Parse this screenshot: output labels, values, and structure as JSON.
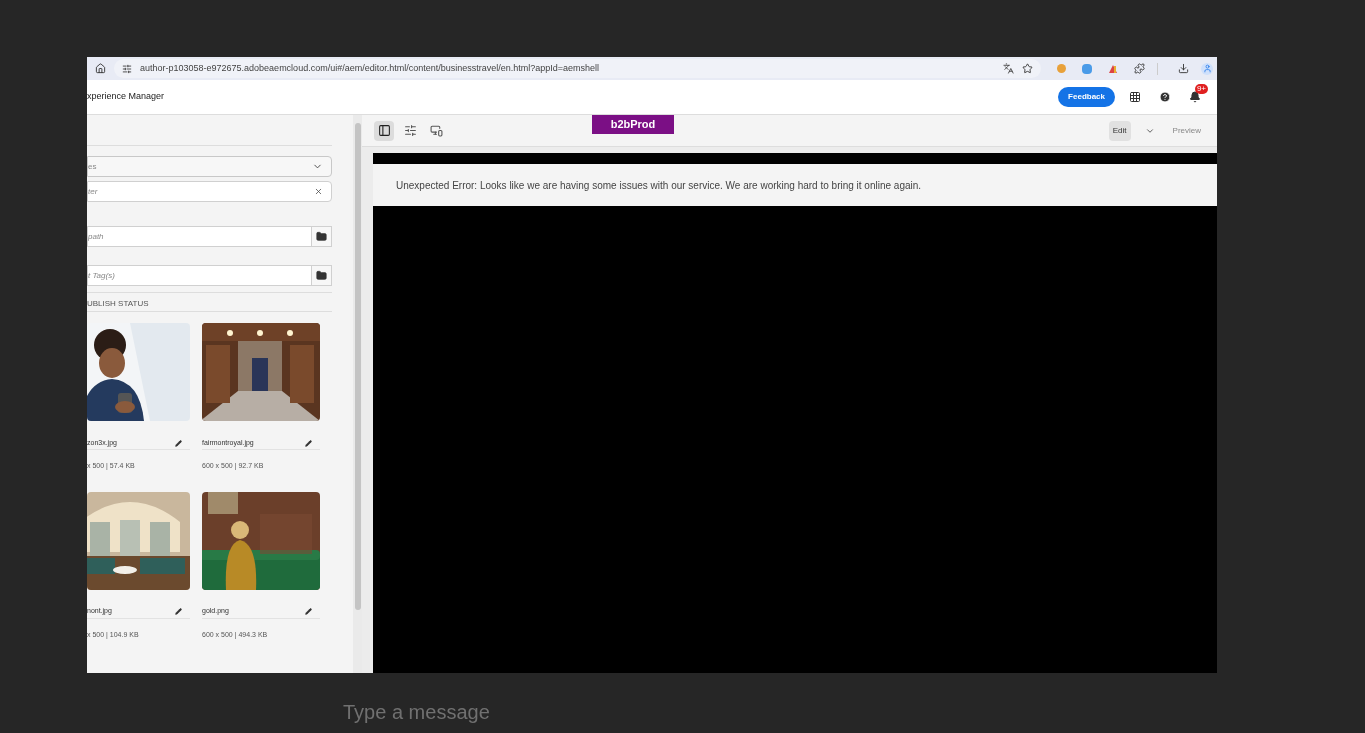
{
  "browser": {
    "url": "author-p103058-e972675.adobeaemcloud.com/ui#/aem/editor.html/content/businesstravel/en.html?appId=aemshell"
  },
  "app_header": {
    "title": "xperience Manager",
    "feedback_button": "Feedback",
    "notification_badge": "9+"
  },
  "sidebar": {
    "fields": [
      {
        "kind": "select",
        "value": "es"
      },
      {
        "kind": "search",
        "placeholder": "ter"
      },
      {
        "kind": "browse",
        "placeholder": "path"
      },
      {
        "kind": "browse",
        "placeholder": "t Tag(s)"
      }
    ],
    "section_label": "UBLISH STATUS",
    "assets": [
      {
        "name": "zon3x.jpg",
        "meta": "x 500 | 57.4 KB"
      },
      {
        "name": "fairmontroyal.jpg",
        "meta": "600 x 500 | 92.7 KB"
      },
      {
        "name": "nont.jpg",
        "meta": "x 500 | 104.9 KB"
      },
      {
        "name": "gold.png",
        "meta": "600 x 500 | 494.3 KB"
      }
    ]
  },
  "editor": {
    "tools": [
      {
        "kind": "panel",
        "selected": true
      },
      {
        "kind": "properties",
        "selected": false
      },
      {
        "kind": "devices",
        "selected": false
      }
    ],
    "environment_tag": "b2bProd",
    "modes": [
      {
        "label": "Edit",
        "selected": true
      },
      {
        "label": "Preview",
        "selected": false
      }
    ],
    "error_message": "Unexpected Error: Looks like we are having some issues with our service. We are working hard to bring it online again."
  },
  "background": {
    "message_placeholder": "Type a message"
  }
}
